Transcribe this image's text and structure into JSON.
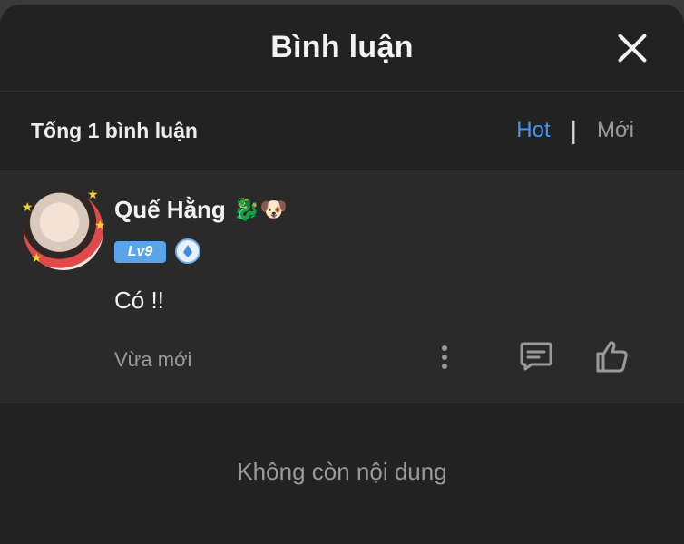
{
  "header": {
    "title": "Bình luận"
  },
  "bar": {
    "total": "Tổng 1 bình luận",
    "sort_hot": "Hot",
    "sort_sep": "|",
    "sort_new": "Mới"
  },
  "comment": {
    "name": "Quế Hằng",
    "emojis": "🐉🐶",
    "level": "Lv9",
    "text": "Có !!",
    "time": "Vừa mới"
  },
  "footer": {
    "end_text": "Không còn nội dung"
  },
  "colors": {
    "accent": "#4c93e8",
    "background": "#222222",
    "comment_bg": "#2a2a2a"
  }
}
